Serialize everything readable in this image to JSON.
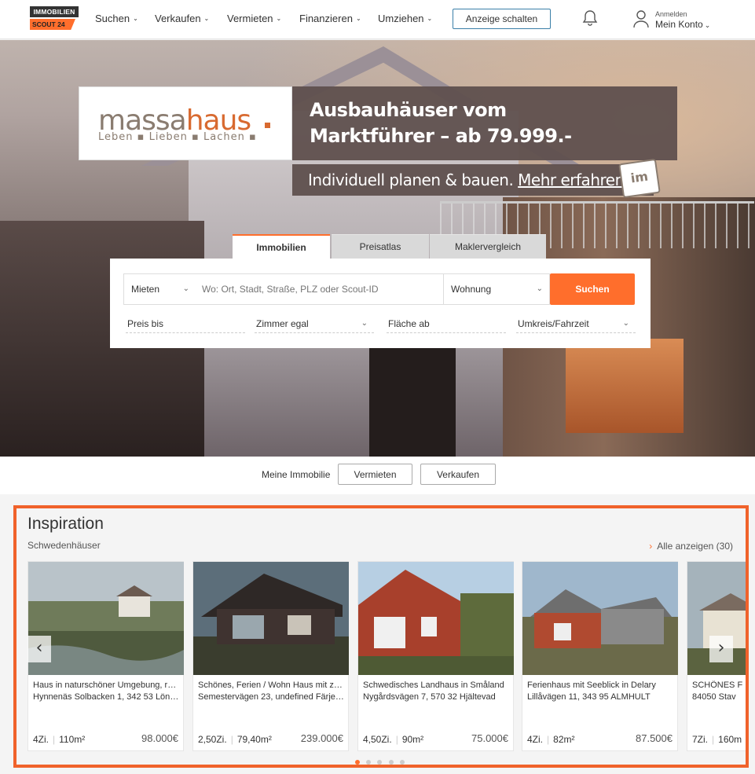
{
  "header": {
    "logo_top": "IMMOBILIEN",
    "logo_bottom": "SCOUT 24",
    "nav": [
      {
        "label": "Suchen"
      },
      {
        "label": "Verkaufen"
      },
      {
        "label": "Vermieten"
      },
      {
        "label": "Finanzieren"
      },
      {
        "label": "Umziehen"
      }
    ],
    "ad_button": "Anzeige schalten",
    "login_small": "Anmelden",
    "login_main": "Mein Konto"
  },
  "banner": {
    "brand_plain": "massa",
    "brand_accent": "haus",
    "slogan": "Leben ▪ Lieben ▪ Lachen ▪",
    "headline": "Ausbauhäuser vom\nMarktführer – ab 79.999.-",
    "sub_prefix": "Individuell planen & bauen. ",
    "sub_link": "Mehr erfahren!",
    "tag": "im"
  },
  "search": {
    "tabs": [
      "Immobilien",
      "Preisatlas",
      "Maklervergleich"
    ],
    "mode": "Mieten",
    "location_placeholder": "Wo: Ort, Stadt, Straße, PLZ oder Scout-ID",
    "type": "Wohnung",
    "submit": "Suchen",
    "filters": {
      "price": "Preis bis",
      "rooms": "Zimmer egal",
      "area": "Fläche ab",
      "radius": "Umkreis/Fahrzeit"
    }
  },
  "meine": {
    "label": "Meine Immobilie",
    "rent": "Vermieten",
    "sell": "Verkaufen"
  },
  "inspiration": {
    "title": "Inspiration",
    "subtitle": "Schwedenhäuser",
    "all_link": "Alle anzeigen (30)",
    "cards": [
      {
        "title": "Haus in naturschöner Umgebung, re...",
        "address": "Hynnenäs Solbacken 1, 342 53 Löna...",
        "rooms": "4Zi.",
        "area": "110m²",
        "price": "98.000€"
      },
      {
        "title": "Schönes, Ferien / Wohn Haus mit zw...",
        "address": "Semestervägen 23, undefined Färjes...",
        "rooms": "2,50Zi.",
        "area": "79,40m²",
        "price": "239.000€"
      },
      {
        "title": "Schwedisches Landhaus in Småland",
        "address": "Nygårdsvägen 7, 570 32 Hjältevad",
        "rooms": "4,50Zi.",
        "area": "90m²",
        "price": "75.000€"
      },
      {
        "title": "Ferienhaus mit Seeblick in Delary",
        "address": "Lillåvägen 11, 343 95 ALMHULT",
        "rooms": "4Zi.",
        "area": "82m²",
        "price": "87.500€"
      },
      {
        "title": "SCHÖNES F",
        "address": "84050 Stav",
        "rooms": "7Zi.",
        "area": "160m",
        "price": ""
      }
    ]
  },
  "colors": {
    "accent": "#ff6e2c",
    "highlight_border": "#f0622b"
  }
}
